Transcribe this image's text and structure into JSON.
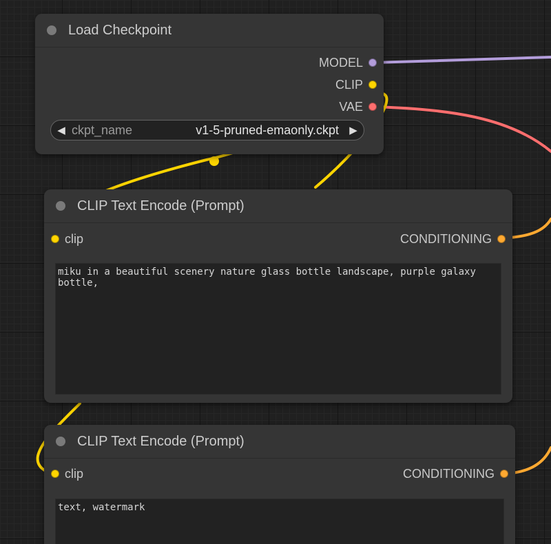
{
  "colors": {
    "model_link": "#b39ddb",
    "clip_link": "#ffd500",
    "vae_link": "#ff6e6e",
    "conditioning_link": "#ffa931",
    "node_bg": "#353535",
    "canvas_bg": "#202020"
  },
  "nodes": {
    "load_checkpoint": {
      "title": "Load Checkpoint",
      "outputs": [
        {
          "label": "MODEL",
          "color": "#b39ddb"
        },
        {
          "label": "CLIP",
          "color": "#ffd500"
        },
        {
          "label": "VAE",
          "color": "#ff6e6e"
        }
      ],
      "widget": {
        "label": "ckpt_name",
        "value": "v1-5-pruned-emaonly.ckpt",
        "left_arrow": "◀",
        "right_arrow": "▶"
      }
    },
    "clip_positive": {
      "title": "CLIP Text Encode (Prompt)",
      "input": {
        "label": "clip",
        "color": "#ffd500"
      },
      "output": {
        "label": "CONDITIONING",
        "color": "#ffa931"
      },
      "text": "miku in a beautiful scenery nature glass bottle landscape, purple galaxy bottle,"
    },
    "clip_negative": {
      "title": "CLIP Text Encode (Prompt)",
      "input": {
        "label": "clip",
        "color": "#ffd500"
      },
      "output": {
        "label": "CONDITIONING",
        "color": "#ffa931"
      },
      "text": "text, watermark"
    }
  }
}
